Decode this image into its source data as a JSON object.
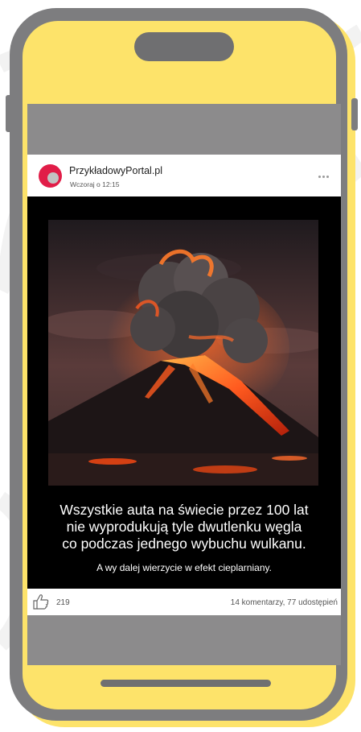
{
  "post": {
    "author": "PrzykładowyPortal.pl",
    "timestamp": "Wczoraj o 12:15",
    "caption_lines": [
      "Wszystkie auta na świecie przez 100 lat",
      "nie wyprodukują tyle dwutlenku węgla",
      "co podczas jednego wybuchu wulkanu."
    ],
    "caption_sub": "A wy dalej wierzycie w efekt cieplarniany.",
    "likes": "219",
    "engagement": "14 komentarzy, 77 udostępień",
    "avatar_color": "#e11d48"
  },
  "icons": {
    "like": "thumbs-up-icon",
    "more": "more-options-icon"
  },
  "colors": {
    "phone_frame": "#7d7d7f",
    "phone_accent": "#fde36a",
    "screen_bg": "#8c8b8c"
  }
}
